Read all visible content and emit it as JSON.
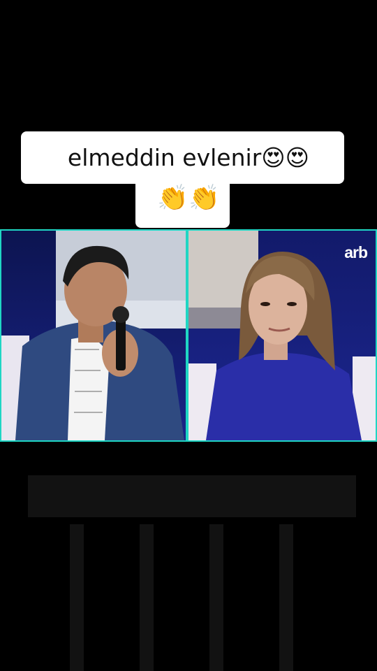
{
  "caption": {
    "line1": "elmeddin evlenir😍😍",
    "line2": "👏👏"
  },
  "video": {
    "channel_logo": "arb",
    "left_panel_icon": "man-with-microphone-icon",
    "right_panel_icon": "woman-listening-icon"
  },
  "colors": {
    "background": "#000000",
    "caption_bg": "#ffffff",
    "panel_border": "#1fd6c4",
    "studio_blue": "#1a1f7a"
  }
}
